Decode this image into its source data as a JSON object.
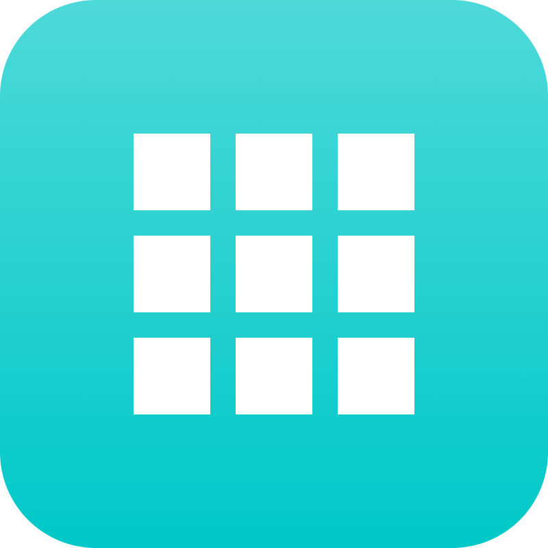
{
  "icon": {
    "name": "grid-icon",
    "gradient_top": "#4ed9d9",
    "gradient_bottom": "#00c8c8",
    "tile_color": "#ffffff",
    "tiles": [
      {
        "name": "grid-tile-1"
      },
      {
        "name": "grid-tile-2"
      },
      {
        "name": "grid-tile-3"
      },
      {
        "name": "grid-tile-4"
      },
      {
        "name": "grid-tile-5"
      },
      {
        "name": "grid-tile-6"
      },
      {
        "name": "grid-tile-7"
      },
      {
        "name": "grid-tile-8"
      },
      {
        "name": "grid-tile-9"
      }
    ]
  }
}
